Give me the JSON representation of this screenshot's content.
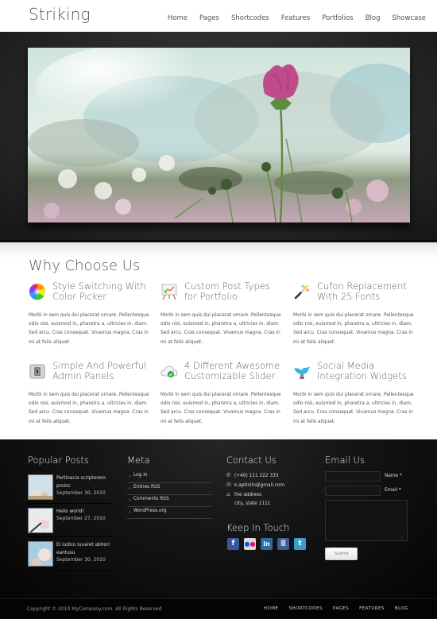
{
  "header": {
    "logo": "Striking",
    "nav": [
      "Home",
      "Pages",
      "Shortcodes",
      "Features",
      "Portfolios",
      "Blog",
      "Showcase"
    ]
  },
  "slider": {
    "image_alt": "Pink cosmos flower against cloudy sky"
  },
  "why": {
    "title": "Why Choose Us",
    "features": [
      {
        "icon": "color-wheel-icon",
        "title_line1": "Style Switching With",
        "title_line2": "Color Picker",
        "body": "Morbi in sem quis dui placerat ornare. Pellentesque odio nisi, euismod in, pharetra a, ultricies in, diam. Sed arcu. Cras consequat. Vivamus magna. Cras in mi at felis aliquet."
      },
      {
        "icon": "easel-chart-icon",
        "title_line1": "Custom Post Types",
        "title_line2": "for Portfolio",
        "body": "Morbi in sem quis dui placerat ornare. Pellentesque odio nisi, euismod in, pharetra a, ultricies in, diam. Sed arcu. Cras consequat. Vivamus magna. Cras in mi at felis aliquet."
      },
      {
        "icon": "magic-wand-icon",
        "title_line1": "Cufon Replacement",
        "title_line2": "With 25 Fonts",
        "body": "Morbi in sem quis dui placerat ornare. Pellentesque odio nisi, euismod in, pharetra a, ultricies in, diam. Sed arcu. Cras consequat. Vivamus magna. Cras in mi at felis aliquet."
      },
      {
        "icon": "admin-panel-icon",
        "title_line1": "Simple And Powerful",
        "title_line2": "Admin Panels",
        "body": "Morbi in sem quis dui placerat ornare. Pellentesque odio nisi, euismod in, pharetra a, ultricies in, diam. Sed arcu. Cras consequat. Vivamus magna. Cras in mi at felis aliquet."
      },
      {
        "icon": "cloud-check-icon",
        "title_line1": "4 Different Awesome",
        "title_line2": "Customizable Slider",
        "body": "Morbi in sem quis dui placerat ornare. Pellentesque odio nisi, euismod in, pharetra a, ultricies in, diam. Sed arcu. Cras consequat. Vivamus magna. Cras in mi at felis aliquet."
      },
      {
        "icon": "twitter-bird-icon",
        "title_line1": "Social Media",
        "title_line2": "Integration Widgets",
        "body": "Morbi in sem quis dui placerat ornare. Pellentesque odio nisi, euismod in, pharetra a, ultricies in, diam. Sed arcu. Cras consequat. Vivamus magna. Cras in mi at felis aliquet."
      }
    ]
  },
  "footer": {
    "popular": {
      "title": "Popular Posts",
      "posts": [
        {
          "title": "Pertinacia scriptorem proinc",
          "date": "September 30, 2010"
        },
        {
          "title": "Hello world!",
          "date": "September 27, 2010"
        },
        {
          "title": "Ei iudico iuvaret abhorr eantusu",
          "date": "September 30, 2010"
        }
      ]
    },
    "meta": {
      "title": "Meta",
      "links": [
        "Log in",
        "Entries RSS",
        "Comments RSS",
        "WordPress.org"
      ]
    },
    "contact": {
      "title": "Contact Us",
      "phone": "(+40) 111 222 333",
      "email": "k.aptinlin@gmail.com",
      "address_line1": "the address",
      "address_line2": "city, state   1111"
    },
    "keep_in_touch": {
      "title": "Keep In Touch",
      "networks": [
        {
          "name": "facebook",
          "glyph": "f",
          "color": "#3b5998"
        },
        {
          "name": "flickr",
          "glyph": "••",
          "color": "#dcdcdc"
        },
        {
          "name": "linkedin",
          "glyph": "in",
          "color": "#2c6ea3"
        },
        {
          "name": "myspace",
          "glyph": "≣",
          "color": "#3d5a99"
        },
        {
          "name": "twitter",
          "glyph": "t",
          "color": "#3aa0c8"
        }
      ]
    },
    "email_form": {
      "title": "Email Us",
      "name_label": "Name *",
      "email_label": "Email *",
      "name_value": "",
      "email_value": "",
      "message_value": "",
      "submit_label": "Submit"
    }
  },
  "bottom": {
    "copyright": "Copyright © 2010 MyCompany.com. All Rights Reserved",
    "nav": [
      "HOME",
      "SHORTCODES",
      "PAGES",
      "FEATURES",
      "BLOG"
    ]
  }
}
